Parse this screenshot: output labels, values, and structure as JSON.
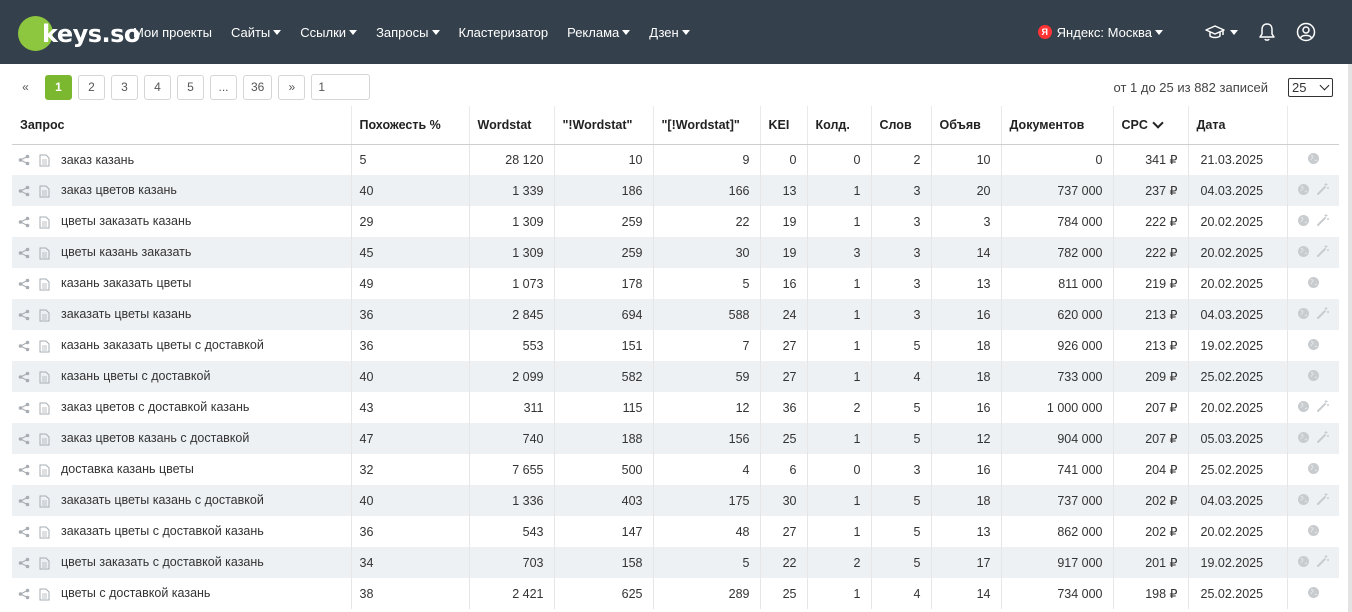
{
  "app": {
    "logo_text": "keys.so",
    "nav": [
      {
        "label": "Мои проекты",
        "dropdown": false
      },
      {
        "label": "Сайты",
        "dropdown": true
      },
      {
        "label": "Ссылки",
        "dropdown": true
      },
      {
        "label": "Запросы",
        "dropdown": true
      },
      {
        "label": "Кластеризатор",
        "dropdown": false
      },
      {
        "label": "Реклама",
        "dropdown": true
      },
      {
        "label": "Дзен",
        "dropdown": true
      }
    ],
    "region": {
      "badge": "Я",
      "label": "Яндекс: Москва"
    },
    "icons": [
      "graduation-cap-icon",
      "bell-icon",
      "user-icon"
    ],
    "accent_color": "#7cb82f",
    "header_color": "#34404b"
  },
  "pagination": {
    "prev": "«",
    "pages": [
      "1",
      "2",
      "3",
      "4",
      "5",
      "...",
      "36"
    ],
    "active_page": "1",
    "next": "»",
    "goto_value": "1",
    "records_text": "от 1 до 25 из 882 записей",
    "per_page": "25"
  },
  "table": {
    "columns": [
      "Запрос",
      "Похожесть %",
      "Wordstat",
      "\"!Wordstat\"",
      "\"[!Wordstat]\"",
      "KEI",
      "Колд.",
      "Слов",
      "Объяв",
      "Документов",
      "CPC",
      "Дата",
      ""
    ],
    "sorted_column": "CPC",
    "rows": [
      {
        "query": "заказ казань",
        "sim": "5",
        "ws": "28 120",
        "ews": "10",
        "bws": "9",
        "kei": "0",
        "kold": "0",
        "words": "2",
        "ads": "10",
        "docs": "0",
        "cpc": "341 ₽",
        "date": "21.03.2025",
        "wand": false
      },
      {
        "query": "заказ цветов казань",
        "sim": "40",
        "ws": "1 339",
        "ews": "186",
        "bws": "166",
        "kei": "13",
        "kold": "1",
        "words": "3",
        "ads": "20",
        "docs": "737 000",
        "cpc": "237 ₽",
        "date": "04.03.2025",
        "wand": true
      },
      {
        "query": "цветы заказать казань",
        "sim": "29",
        "ws": "1 309",
        "ews": "259",
        "bws": "22",
        "kei": "19",
        "kold": "1",
        "words": "3",
        "ads": "3",
        "docs": "784 000",
        "cpc": "222 ₽",
        "date": "20.02.2025",
        "wand": true
      },
      {
        "query": "цветы казань заказать",
        "sim": "45",
        "ws": "1 309",
        "ews": "259",
        "bws": "30",
        "kei": "19",
        "kold": "3",
        "words": "3",
        "ads": "14",
        "docs": "782 000",
        "cpc": "222 ₽",
        "date": "20.02.2025",
        "wand": true
      },
      {
        "query": "казань заказать цветы",
        "sim": "49",
        "ws": "1 073",
        "ews": "178",
        "bws": "5",
        "kei": "16",
        "kold": "1",
        "words": "3",
        "ads": "13",
        "docs": "811 000",
        "cpc": "219 ₽",
        "date": "20.02.2025",
        "wand": false
      },
      {
        "query": "заказать цветы казань",
        "sim": "36",
        "ws": "2 845",
        "ews": "694",
        "bws": "588",
        "kei": "24",
        "kold": "1",
        "words": "3",
        "ads": "16",
        "docs": "620 000",
        "cpc": "213 ₽",
        "date": "04.03.2025",
        "wand": true
      },
      {
        "query": "казань заказать цветы с доставкой",
        "sim": "36",
        "ws": "553",
        "ews": "151",
        "bws": "7",
        "kei": "27",
        "kold": "1",
        "words": "5",
        "ads": "18",
        "docs": "926 000",
        "cpc": "213 ₽",
        "date": "19.02.2025",
        "wand": false
      },
      {
        "query": "казань цветы с доставкой",
        "sim": "40",
        "ws": "2 099",
        "ews": "582",
        "bws": "59",
        "kei": "27",
        "kold": "1",
        "words": "4",
        "ads": "18",
        "docs": "733 000",
        "cpc": "209 ₽",
        "date": "25.02.2025",
        "wand": false
      },
      {
        "query": "заказ цветов с доставкой казань",
        "sim": "43",
        "ws": "311",
        "ews": "115",
        "bws": "12",
        "kei": "36",
        "kold": "2",
        "words": "5",
        "ads": "16",
        "docs": "1 000 000",
        "cpc": "207 ₽",
        "date": "20.02.2025",
        "wand": true
      },
      {
        "query": "заказ цветов казань с доставкой",
        "sim": "47",
        "ws": "740",
        "ews": "188",
        "bws": "156",
        "kei": "25",
        "kold": "1",
        "words": "5",
        "ads": "12",
        "docs": "904 000",
        "cpc": "207 ₽",
        "date": "05.03.2025",
        "wand": true
      },
      {
        "query": "доставка казань цветы",
        "sim": "32",
        "ws": "7 655",
        "ews": "500",
        "bws": "4",
        "kei": "6",
        "kold": "0",
        "words": "3",
        "ads": "16",
        "docs": "741 000",
        "cpc": "204 ₽",
        "date": "25.02.2025",
        "wand": false
      },
      {
        "query": "заказать цветы казань с доставкой",
        "sim": "40",
        "ws": "1 336",
        "ews": "403",
        "bws": "175",
        "kei": "30",
        "kold": "1",
        "words": "5",
        "ads": "18",
        "docs": "737 000",
        "cpc": "202 ₽",
        "date": "04.03.2025",
        "wand": true
      },
      {
        "query": "заказать цветы с доставкой казань",
        "sim": "36",
        "ws": "543",
        "ews": "147",
        "bws": "48",
        "kei": "27",
        "kold": "1",
        "words": "5",
        "ads": "13",
        "docs": "862 000",
        "cpc": "202 ₽",
        "date": "20.02.2025",
        "wand": false
      },
      {
        "query": "цветы заказать с доставкой казань",
        "sim": "34",
        "ws": "703",
        "ews": "158",
        "bws": "5",
        "kei": "22",
        "kold": "2",
        "words": "5",
        "ads": "17",
        "docs": "917 000",
        "cpc": "201 ₽",
        "date": "19.02.2025",
        "wand": true
      },
      {
        "query": "цветы с доставкой казань",
        "sim": "38",
        "ws": "2 421",
        "ews": "625",
        "bws": "289",
        "kei": "25",
        "kold": "1",
        "words": "4",
        "ads": "14",
        "docs": "734 000",
        "cpc": "198 ₽",
        "date": "25.02.2025",
        "wand": false
      }
    ]
  }
}
